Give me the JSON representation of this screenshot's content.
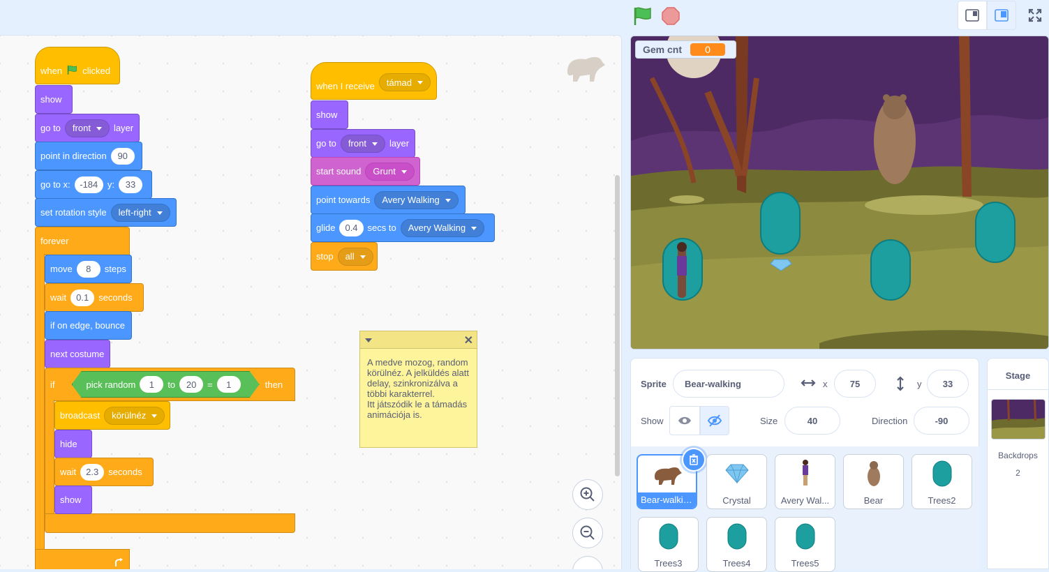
{
  "topbar": {
    "green_flag": "green-flag-icon",
    "stop": "stop-icon"
  },
  "scripts": {
    "script1": {
      "when_clicked": [
        "when",
        "clicked"
      ],
      "show": "show",
      "go_to_layer": {
        "a": "go to",
        "value": "front",
        "b": "layer"
      },
      "point_direction": {
        "a": "point in direction",
        "value": "90"
      },
      "go_to_xy": {
        "a": "go to x:",
        "x": "-184",
        "b": "y:",
        "y": "33"
      },
      "rotation": {
        "a": "set rotation style",
        "value": "left-right"
      },
      "forever": "forever",
      "move": {
        "a": "move",
        "value": "8",
        "b": "steps"
      },
      "wait1": {
        "a": "wait",
        "value": "0.1",
        "b": "seconds"
      },
      "bounce": "if on edge, bounce",
      "next_costume": "next costume",
      "if_block": {
        "if": "if",
        "random": "pick random",
        "from": "1",
        "to_label": "to",
        "to": "20",
        "eq": "=",
        "cmp": "1",
        "then": "then"
      },
      "broadcast": {
        "a": "broadcast",
        "value": "körülnéz"
      },
      "hide": "hide",
      "wait2": {
        "a": "wait",
        "value": "2.3",
        "b": "seconds"
      },
      "show2": "show"
    },
    "script2": {
      "receive": {
        "a": "when I receive",
        "value": "támad"
      },
      "show": "show",
      "go_to_layer": {
        "a": "go to",
        "value": "front",
        "b": "layer"
      },
      "sound": {
        "a": "start sound",
        "value": "Grunt"
      },
      "towards": {
        "a": "point towards",
        "value": "Avery Walking"
      },
      "glide": {
        "a": "glide",
        "secs": "0.4",
        "b": "secs to",
        "value": "Avery Walking"
      },
      "stop": {
        "a": "stop",
        "value": "all"
      }
    }
  },
  "note": {
    "text": "A medve mozog, random körülnéz. A jelküldés alatt delay, szinkronizálva a többi karakterrel.\nItt játszódik le a támadás animációja is."
  },
  "stage": {
    "monitor_label": "Gem cnt",
    "monitor_value": "0"
  },
  "sprite_info": {
    "sprite_label": "Sprite",
    "sprite_name": "Bear-walking",
    "x_label": "x",
    "x": "75",
    "y_label": "y",
    "y": "33",
    "show_label": "Show",
    "size_label": "Size",
    "size": "40",
    "direction_label": "Direction",
    "direction": "-90"
  },
  "sprites": [
    {
      "name": "Bear-walking",
      "selected": true
    },
    {
      "name": "Crystal"
    },
    {
      "name": "Avery Wal..."
    },
    {
      "name": "Bear"
    },
    {
      "name": "Trees2"
    },
    {
      "name": "Trees3"
    },
    {
      "name": "Trees4"
    },
    {
      "name": "Trees5"
    }
  ],
  "stage_panel": {
    "title": "Stage",
    "backdrops_label": "Backdrops",
    "backdrops_count": "2"
  }
}
